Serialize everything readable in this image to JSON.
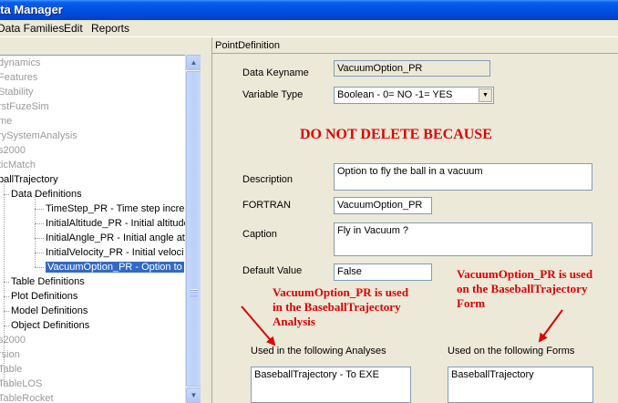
{
  "window": {
    "title": "ata Manager"
  },
  "menu": [
    "Data Families",
    "Edit",
    "Reports"
  ],
  "tree": {
    "items": [
      {
        "label": "dynamics",
        "color": "gray"
      },
      {
        "label": "Features",
        "color": "gray"
      },
      {
        "label": "Stability",
        "color": "gray"
      },
      {
        "label": "rstFuzeSim",
        "color": "gray"
      },
      {
        "label": "me",
        "color": "gray"
      },
      {
        "label": "rySystemAnalysis",
        "color": "gray"
      },
      {
        "label": "s2000",
        "color": "gray"
      },
      {
        "label": "ticMatch",
        "color": "gray"
      },
      {
        "label": "ballTrajectory",
        "color": "black"
      },
      {
        "label": "Data Definitions",
        "color": "black"
      },
      {
        "label": "TimeStep_PR  -  Time step incre",
        "color": "black"
      },
      {
        "label": "InitialAltitude_PR  -  Initial altitude",
        "color": "black"
      },
      {
        "label": "InitialAngle_PR  -  Initial angle at",
        "color": "black"
      },
      {
        "label": "InitialVelocity_PR  -  Initial veloci",
        "color": "black"
      },
      {
        "label": "VacuumOption_PR  -  Option to",
        "color": "selected"
      },
      {
        "label": "Table Definitions",
        "color": "black"
      },
      {
        "label": "Plot Definitions",
        "color": "black"
      },
      {
        "label": "Model Definitions",
        "color": "black"
      },
      {
        "label": "Object Definitions",
        "color": "black"
      },
      {
        "label": "s2000",
        "color": "gray"
      },
      {
        "label": "rsion",
        "color": "gray"
      },
      {
        "label": "Table",
        "color": "gray"
      },
      {
        "label": "TableLOS",
        "color": "gray"
      },
      {
        "label": "TableRocket",
        "color": "gray"
      }
    ]
  },
  "panel": {
    "header": "PointDefinition",
    "data_keyname_label": "Data Keyname",
    "data_keyname_value": "VacuumOption_PR",
    "variable_type_label": "Variable Type",
    "variable_type_value": "Boolean - 0= NO -1= YES",
    "warning": "DO NOT DELETE BECAUSE",
    "description_label": "Description",
    "description_value": "Option to fly the ball in a vacuum",
    "fortran_label": "FORTRAN",
    "fortran_value": "VacuumOption_PR",
    "caption_label": "Caption",
    "caption_value": "Fly in Vacuum ?",
    "default_label": "Default Value",
    "default_value": "False",
    "analyses_label": "Used in the following Analyses",
    "analyses_value": "BaseballTrajectory  -  To EXE",
    "forms_label": "Used on the following Forms",
    "forms_value": "BaseballTrajectory"
  },
  "annotations": {
    "analysis_note_1": "VacuumOption_PR is used",
    "analysis_note_2": "in the BaseballTrajectory",
    "analysis_note_3": "Analysis",
    "form_note_1": "VacuumOption_PR is used",
    "form_note_2": "on the BaseballTrajectory",
    "form_note_3": "Form"
  },
  "colors": {
    "annotation": "#e00000",
    "selection": "#316ac5",
    "titlebar": "#0054e3"
  },
  "icons": {
    "scroll_up": "up-arrow-icon",
    "scroll_down": "down-arrow-icon",
    "combo": "dropdown-arrow-icon"
  }
}
